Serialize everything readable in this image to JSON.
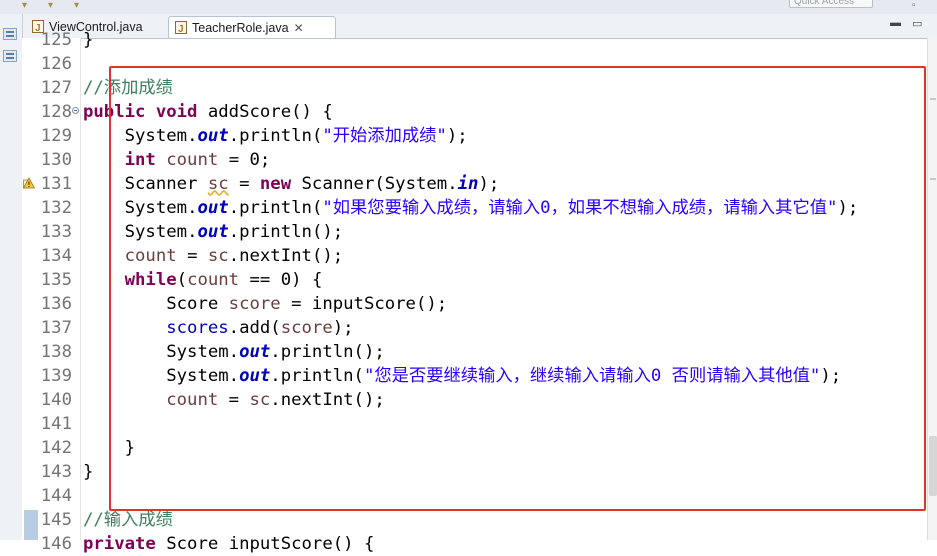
{
  "editor": {
    "tabs": [
      {
        "label": "ViewControl.java",
        "active": false
      },
      {
        "label": "TeacherRole.java",
        "active": true
      }
    ],
    "tab_close_glyph": "✕",
    "quick_access_placeholder": "Quick Access",
    "window_controls": {
      "minimize": "▬",
      "maximize": "▭"
    },
    "icons": {
      "file": "java-file-icon",
      "fold": "collapse-icon",
      "warning": "warning-icon",
      "close": "close-icon"
    },
    "colors": {
      "keyword": "#7f0055",
      "string": "#2a00ff",
      "comment": "#3f7f5f",
      "field": "#0000c0",
      "local_variable": "#6a3e3e",
      "line_number": "#747474",
      "highlight_box": "#e8302a"
    }
  },
  "lines": [
    {
      "num": "125",
      "code": "}"
    },
    {
      "num": "126",
      "code": ""
    },
    {
      "num": "127",
      "code": "//添加成绩"
    },
    {
      "num": "128",
      "code": "public void addScore() {"
    },
    {
      "num": "129",
      "code": "System.out.println(\"开始添加成绩\");"
    },
    {
      "num": "130",
      "code": "int count = 0;"
    },
    {
      "num": "131",
      "code": "Scanner sc = new Scanner(System.in);"
    },
    {
      "num": "132",
      "code": "System.out.println(\"如果您要输入成绩，请输入0，如果不想输入成绩，请输入其它值\");"
    },
    {
      "num": "133",
      "code": "System.out.println();"
    },
    {
      "num": "134",
      "code": "count = sc.nextInt();"
    },
    {
      "num": "135",
      "code": "while(count == 0) {"
    },
    {
      "num": "136",
      "code": "Score score = inputScore();"
    },
    {
      "num": "137",
      "code": "scores.add(score);"
    },
    {
      "num": "138",
      "code": "System.out.println();"
    },
    {
      "num": "139",
      "code": "System.out.println(\"您是否要继续输入，继续输入请输入0 否则请输入其他值\");"
    },
    {
      "num": "140",
      "code": "count = sc.nextInt();"
    },
    {
      "num": "141",
      "code": ""
    },
    {
      "num": "142",
      "code": "}"
    },
    {
      "num": "143",
      "code": "}"
    },
    {
      "num": "144",
      "code": ""
    },
    {
      "num": "145",
      "code": "//输入成绩"
    },
    {
      "num": "146",
      "code": "private Score inputScore() {"
    }
  ]
}
